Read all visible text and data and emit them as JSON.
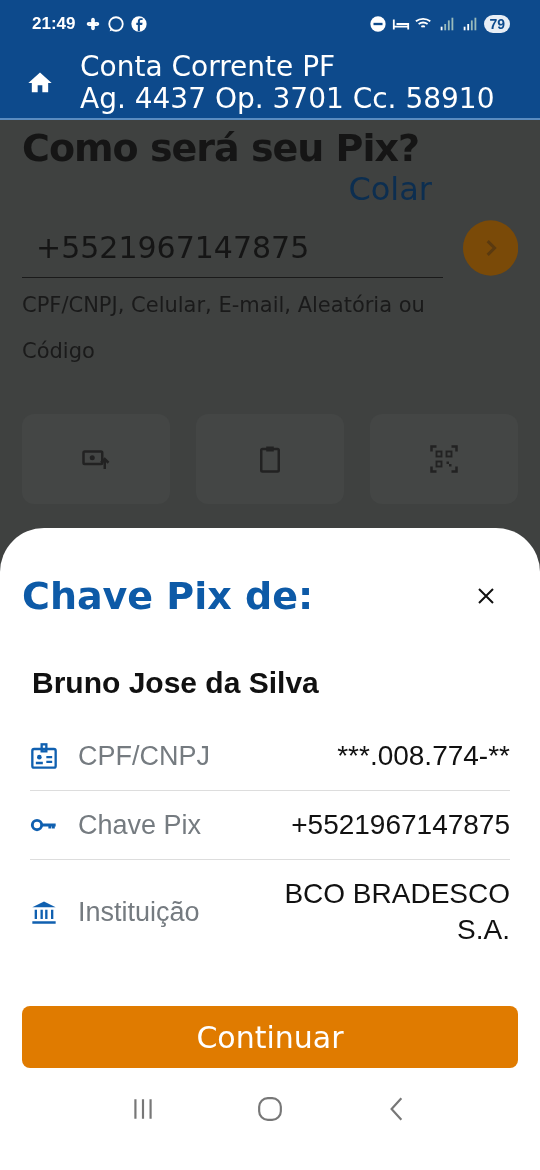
{
  "status_bar": {
    "time": "21:49",
    "battery": "79"
  },
  "header": {
    "title": "Conta Corrente PF",
    "account": "Ag. 4437 Op. 3701 Cc. 58910"
  },
  "page": {
    "heading": "Como será seu Pix?",
    "paste_link": "Colar",
    "key_field": {
      "value": "+5521967147875"
    },
    "hint": "CPF/CNPJ, Celular, E-mail, Aleatória ou Código"
  },
  "sheet": {
    "title": "Chave Pix de:",
    "name": "Bruno Jose da Silva",
    "rows": [
      {
        "kind": "document",
        "label": "CPF/CNPJ",
        "value": "***.008.774-**"
      },
      {
        "kind": "key",
        "label": "Chave Pix",
        "value": "+5521967147875"
      },
      {
        "kind": "bank",
        "label": "Instituição",
        "value": "BCO BRADESCO S.A."
      }
    ],
    "button": "Continuar"
  }
}
